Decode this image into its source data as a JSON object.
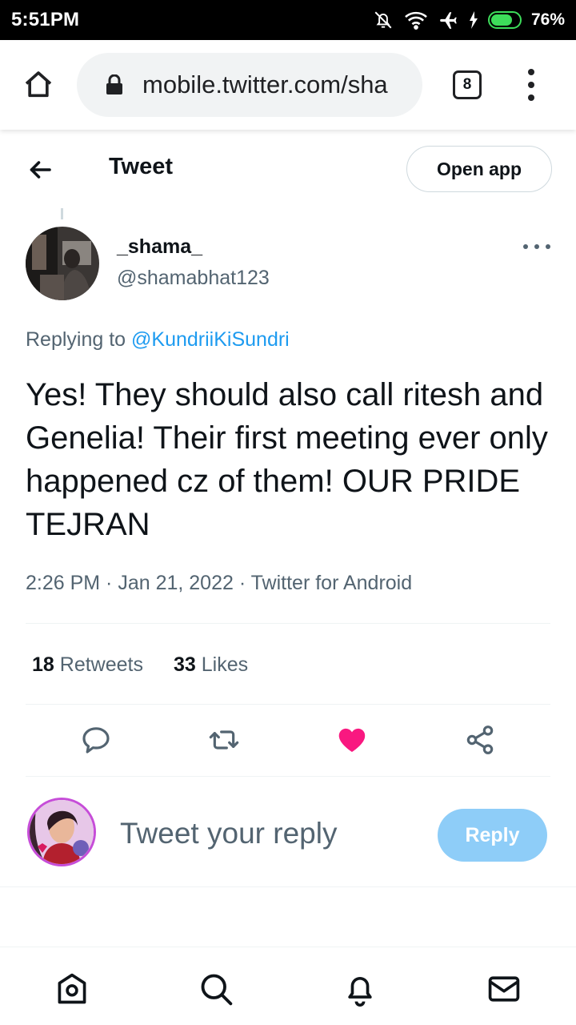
{
  "status_bar": {
    "time": "5:51PM",
    "battery_percent": "76%",
    "icons": [
      "bell-off-icon",
      "wifi-icon",
      "airplane-icon",
      "charging-icon",
      "battery-icon"
    ]
  },
  "browser": {
    "url": "mobile.twitter.com/sha",
    "tab_count": "8"
  },
  "header": {
    "title": "Tweet",
    "open_app_label": "Open app"
  },
  "tweet": {
    "author_name": "_shama_",
    "author_handle": "@shamabhat123",
    "replying_prefix": "Replying to",
    "replying_to": "@KundriiKiSundri",
    "text": "Yes! They should also call ritesh and Genelia! Their first meeting ever only happened cz of them! OUR PRIDE TEJRAN",
    "timestamp": "2:26 PM · Jan 21, 2022 · Twitter for Android",
    "retweets_count": "18",
    "retweets_label": "Retweets",
    "likes_count": "33",
    "likes_label": "Likes"
  },
  "compose": {
    "placeholder": "Tweet your reply",
    "reply_label": "Reply"
  },
  "colors": {
    "accent": "#1d9bf0",
    "like": "#f91880",
    "reply_disabled": "#8ecdf8",
    "secondary_text": "#536471"
  }
}
